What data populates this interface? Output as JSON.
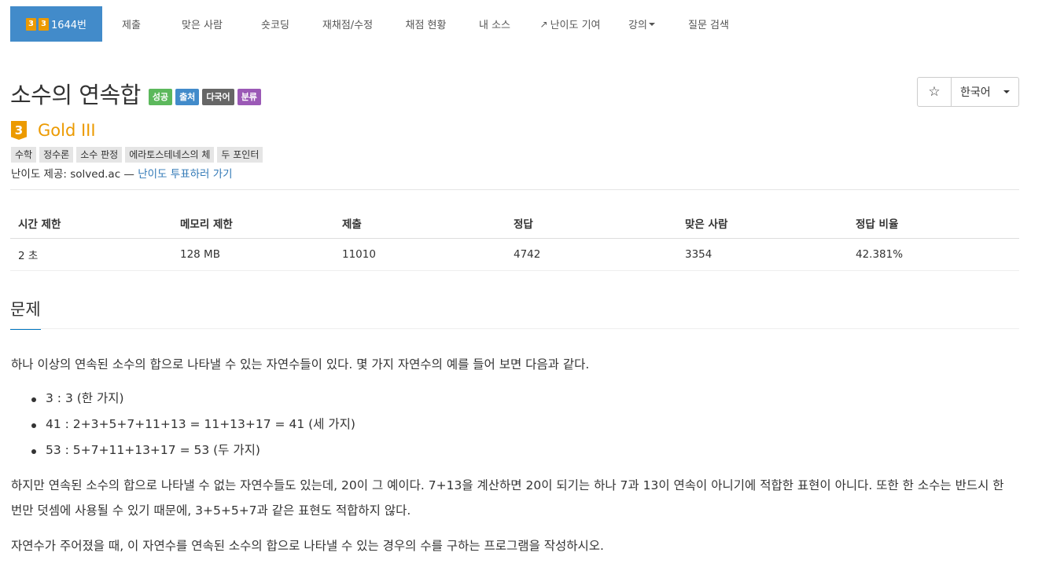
{
  "nav": {
    "problem_tab": {
      "tier_digit_a": "3",
      "tier_digit_b": "3",
      "label": "1644번"
    },
    "items": [
      "제출",
      "맞은 사람",
      "숏코딩",
      "재채점/수정",
      "채점 현황",
      "내 소스",
      "난이도 기여",
      "강의",
      "질문 검색"
    ]
  },
  "problem": {
    "title": "소수의 연속합",
    "labels": [
      "성공",
      "출처",
      "다국어",
      "분류"
    ],
    "star_icon": "☆",
    "language": "한국어",
    "tier_digit": "3",
    "tier_name": "Gold III",
    "tags": [
      "수학",
      "정수론",
      "소수 판정",
      "에라토스테네스의 체",
      "두 포인터"
    ],
    "difficulty_prefix": "난이도 제공: solved.ac — ",
    "difficulty_link": "난이도 투표하러 가기"
  },
  "stats": {
    "headers": [
      "시간 제한",
      "메모리 제한",
      "제출",
      "정답",
      "맞은 사람",
      "정답 비율"
    ],
    "values": [
      "2 초",
      "128 MB",
      "11010",
      "4742",
      "3354",
      "42.381%"
    ]
  },
  "section": {
    "title": "문제",
    "p1": "하나 이상의 연속된 소수의 합으로 나타낼 수 있는 자연수들이 있다. 몇 가지 자연수의 예를 들어 보면 다음과 같다.",
    "examples": [
      "3 : 3 (한 가지)",
      "41 : 2+3+5+7+11+13 = 11+13+17 = 41 (세 가지)",
      "53 : 5+7+11+13+17 = 53 (두 가지)"
    ],
    "p2": "하지만 연속된 소수의 합으로 나타낼 수 없는 자연수들도 있는데, 20이 그 예이다. 7+13을 계산하면 20이 되기는 하나 7과 13이 연속이 아니기에 적합한 표현이 아니다. 또한 한 소수는 반드시 한 번만 덧셈에 사용될 수 있기 때문에, 3+5+5+7과 같은 표현도 적합하지 않다.",
    "p3": "자연수가 주어졌을 때, 이 자연수를 연속된 소수의 합으로 나타낼 수 있는 경우의 수를 구하는 프로그램을 작성하시오."
  },
  "colors": {
    "accent": "#428bca",
    "gold": "#ec9a00",
    "success": "#5cb85c",
    "purple": "#9b59b6",
    "section_underline": "#0076c0"
  }
}
